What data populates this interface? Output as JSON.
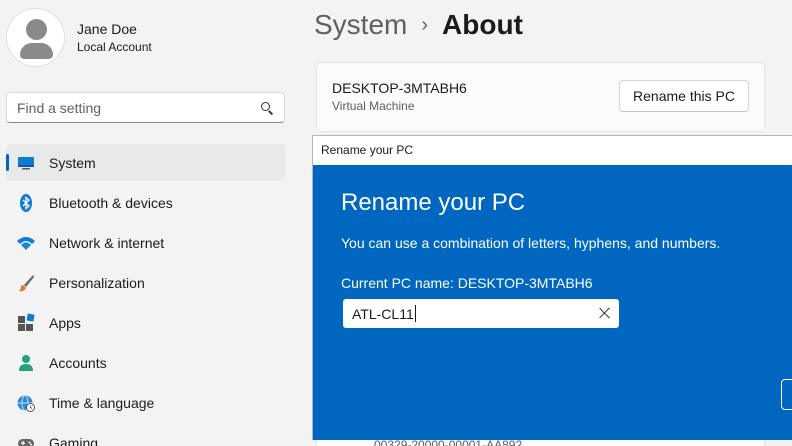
{
  "profile": {
    "name": "Jane Doe",
    "account_type": "Local Account"
  },
  "search": {
    "placeholder": "Find a setting"
  },
  "nav": {
    "items": [
      {
        "label": "System",
        "icon": "monitor-icon",
        "active": true
      },
      {
        "label": "Bluetooth & devices",
        "icon": "bluetooth-icon"
      },
      {
        "label": "Network & internet",
        "icon": "wifi-icon"
      },
      {
        "label": "Personalization",
        "icon": "brush-icon"
      },
      {
        "label": "Apps",
        "icon": "apps-icon"
      },
      {
        "label": "Accounts",
        "icon": "person-icon"
      },
      {
        "label": "Time & language",
        "icon": "globe-clock-icon"
      },
      {
        "label": "Gaming",
        "icon": "gamepad-icon"
      }
    ]
  },
  "breadcrumb": {
    "parent": "System",
    "separator": "›",
    "current": "About"
  },
  "device": {
    "name": "DESKTOP-3MTABH6",
    "type": "Virtual Machine",
    "rename_button": "Rename this PC"
  },
  "product_id_partial": "00329-20000-00001-AA892",
  "dialog": {
    "window_title": "Rename your PC",
    "heading": "Rename your PC",
    "description": "You can use a combination of letters, hyphens, and numbers.",
    "current_name_label": "Current PC name: DESKTOP-3MTABH6",
    "input_value": "ATL-CL11"
  },
  "colors": {
    "accent": "#0067c0",
    "background": "#f3f3f3"
  }
}
